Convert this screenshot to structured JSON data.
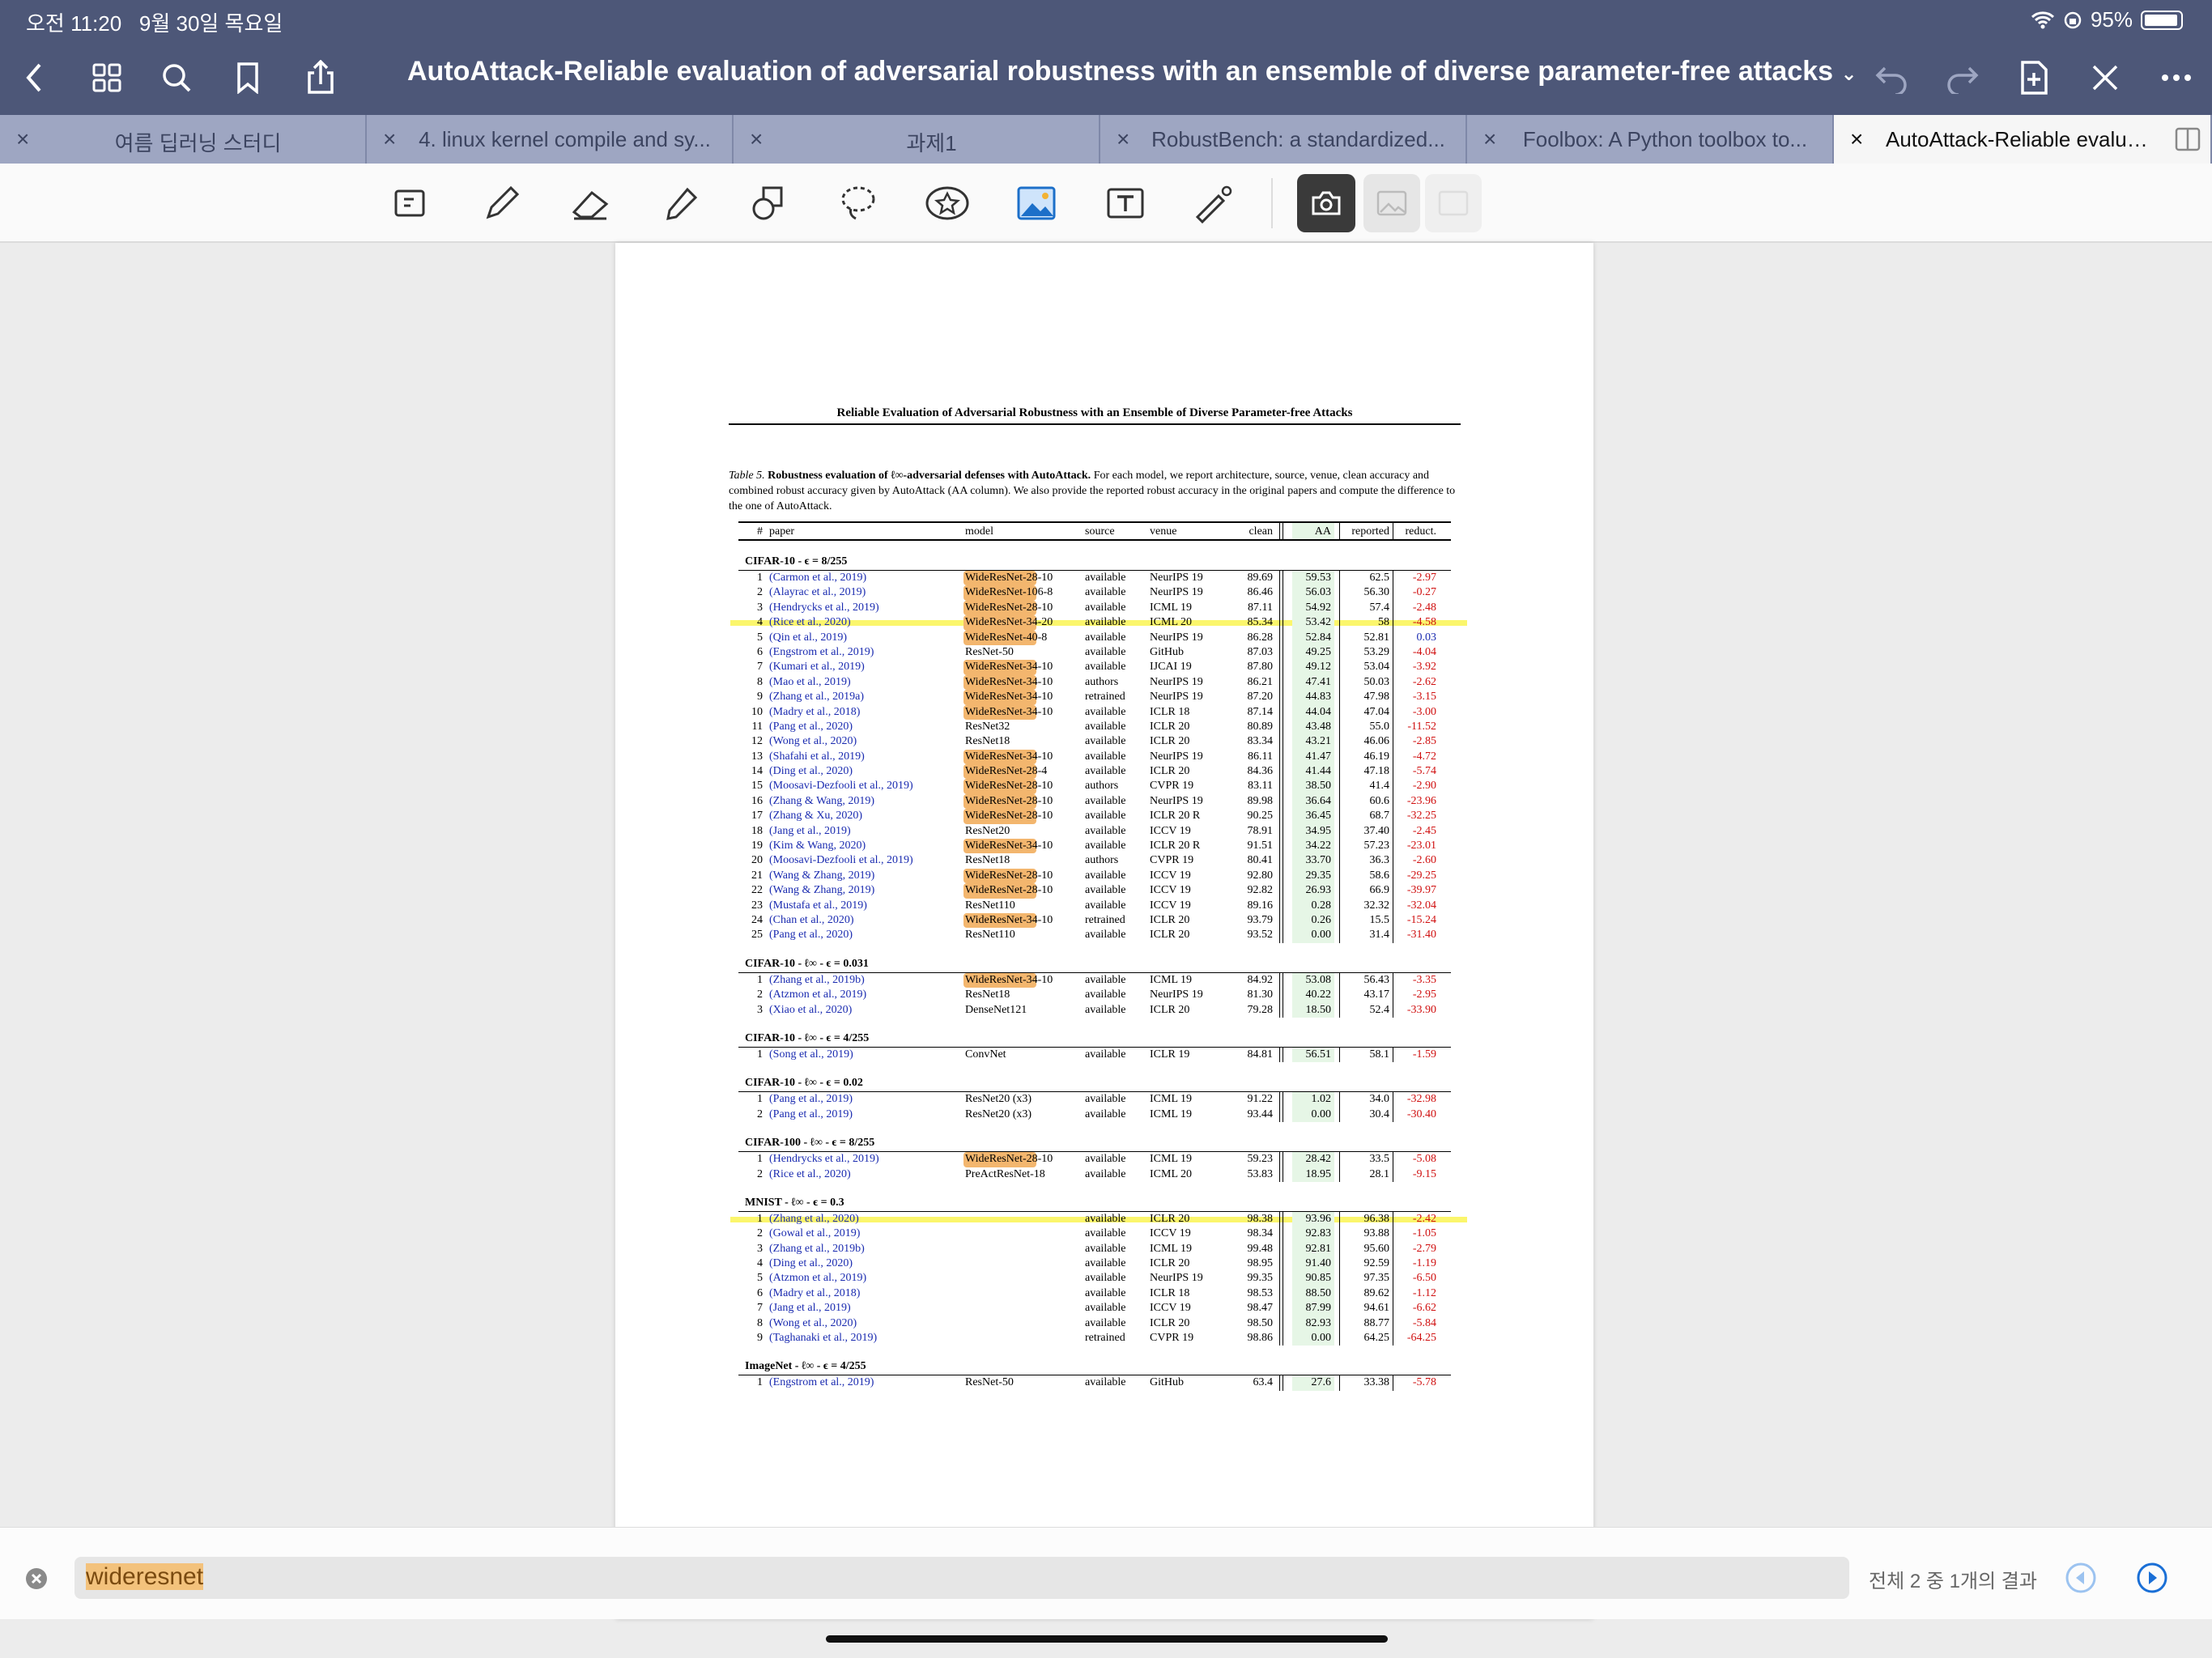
{
  "status": {
    "time": "오전 11:20",
    "date": "9월 30일 목요일",
    "battery": "95%"
  },
  "nav": {
    "title": "AutoAttack-Reliable evaluation of adversarial robustness with an ensemble of diverse parameter-free attacks"
  },
  "tabs": [
    {
      "label": "여름 딥러닝 스터디"
    },
    {
      "label": "4. linux kernel compile and sy..."
    },
    {
      "label": "과제1"
    },
    {
      "label": "RobustBench: a standardized..."
    },
    {
      "label": "Foolbox: A Python toolbox to..."
    },
    {
      "label": "AutoAttack-Reliable evalua..."
    }
  ],
  "doc": {
    "running_head": "Reliable Evaluation of Adversarial Robustness with an Ensemble of Diverse Parameter-free Attacks",
    "caption": {
      "label": "Table 5.",
      "bold": "Robustness evaluation of ℓ∞-adversarial defenses with AutoAttack.",
      "rest": "For each model, we report architecture, source, venue, clean accuracy and combined robust accuracy given by AutoAttack (AA column). We also provide the reported robust accuracy in the original papers and compute the difference to the one of AutoAttack."
    },
    "headers": {
      "num": "#",
      "paper": "paper",
      "model": "model",
      "source": "source",
      "venue": "venue",
      "clean": "clean",
      "aa": "AA",
      "reported": "reported",
      "reduct": "reduct."
    },
    "sections": [
      {
        "title": "CIFAR-10 - ϵ = 8/255",
        "rows": [
          {
            "n": "1",
            "paper": "(Carmon et al., 2019)",
            "model": "WideResNet-28-10",
            "source": "available",
            "venue": "NeurIPS 19",
            "clean": "89.69",
            "aa": "59.53",
            "reported": "62.5",
            "reduct": "-2.97"
          },
          {
            "n": "2",
            "paper": "(Alayrac et al., 2019)",
            "model": "WideResNet-106-8",
            "source": "available",
            "venue": "NeurIPS 19",
            "clean": "86.46",
            "aa": "56.03",
            "reported": "56.30",
            "reduct": "-0.27"
          },
          {
            "n": "3",
            "paper": "(Hendrycks et al., 2019)",
            "model": "WideResNet-28-10",
            "source": "available",
            "venue": "ICML 19",
            "clean": "87.11",
            "aa": "54.92",
            "reported": "57.4",
            "reduct": "-2.48"
          },
          {
            "n": "4",
            "paper": "(Rice et al., 2020)",
            "model": "WideResNet-34-20",
            "source": "available",
            "venue": "ICML 20",
            "clean": "85.34",
            "aa": "53.42",
            "reported": "58",
            "reduct": "-4.58"
          },
          {
            "n": "5",
            "paper": "(Qin et al., 2019)",
            "model": "WideResNet-40-8",
            "source": "available",
            "venue": "NeurIPS 19",
            "clean": "86.28",
            "aa": "52.84",
            "reported": "52.81",
            "reduct": "0.03"
          },
          {
            "n": "6",
            "paper": "(Engstrom et al., 2019)",
            "model": "ResNet-50",
            "source": "available",
            "venue": "GitHub",
            "clean": "87.03",
            "aa": "49.25",
            "reported": "53.29",
            "reduct": "-4.04"
          },
          {
            "n": "7",
            "paper": "(Kumari et al., 2019)",
            "model": "WideResNet-34-10",
            "source": "available",
            "venue": "IJCAI 19",
            "clean": "87.80",
            "aa": "49.12",
            "reported": "53.04",
            "reduct": "-3.92"
          },
          {
            "n": "8",
            "paper": "(Mao et al., 2019)",
            "model": "WideResNet-34-10",
            "source": "authors",
            "venue": "NeurIPS 19",
            "clean": "86.21",
            "aa": "47.41",
            "reported": "50.03",
            "reduct": "-2.62"
          },
          {
            "n": "9",
            "paper": "(Zhang et al., 2019a)",
            "model": "WideResNet-34-10",
            "source": "retrained",
            "venue": "NeurIPS 19",
            "clean": "87.20",
            "aa": "44.83",
            "reported": "47.98",
            "reduct": "-3.15"
          },
          {
            "n": "10",
            "paper": "(Madry et al., 2018)",
            "model": "WideResNet-34-10",
            "source": "available",
            "venue": "ICLR 18",
            "clean": "87.14",
            "aa": "44.04",
            "reported": "47.04",
            "reduct": "-3.00"
          },
          {
            "n": "11",
            "paper": "(Pang et al., 2020)",
            "model": "ResNet32",
            "source": "available",
            "venue": "ICLR 20",
            "clean": "80.89",
            "aa": "43.48",
            "reported": "55.0",
            "reduct": "-11.52"
          },
          {
            "n": "12",
            "paper": "(Wong et al., 2020)",
            "model": "ResNet18",
            "source": "available",
            "venue": "ICLR 20",
            "clean": "83.34",
            "aa": "43.21",
            "reported": "46.06",
            "reduct": "-2.85"
          },
          {
            "n": "13",
            "paper": "(Shafahi et al., 2019)",
            "model": "WideResNet-34-10",
            "source": "available",
            "venue": "NeurIPS 19",
            "clean": "86.11",
            "aa": "41.47",
            "reported": "46.19",
            "reduct": "-4.72"
          },
          {
            "n": "14",
            "paper": "(Ding et al., 2020)",
            "model": "WideResNet-28-4",
            "source": "available",
            "venue": "ICLR 20",
            "clean": "84.36",
            "aa": "41.44",
            "reported": "47.18",
            "reduct": "-5.74"
          },
          {
            "n": "15",
            "paper": "(Moosavi-Dezfooli et al., 2019)",
            "model": "WideResNet-28-10",
            "source": "authors",
            "venue": "CVPR 19",
            "clean": "83.11",
            "aa": "38.50",
            "reported": "41.4",
            "reduct": "-2.90"
          },
          {
            "n": "16",
            "paper": "(Zhang & Wang, 2019)",
            "model": "WideResNet-28-10",
            "source": "available",
            "venue": "NeurIPS 19",
            "clean": "89.98",
            "aa": "36.64",
            "reported": "60.6",
            "reduct": "-23.96"
          },
          {
            "n": "17",
            "paper": "(Zhang & Xu, 2020)",
            "model": "WideResNet-28-10",
            "source": "available",
            "venue": "ICLR 20 R",
            "clean": "90.25",
            "aa": "36.45",
            "reported": "68.7",
            "reduct": "-32.25"
          },
          {
            "n": "18",
            "paper": "(Jang et al., 2019)",
            "model": "ResNet20",
            "source": "available",
            "venue": "ICCV 19",
            "clean": "78.91",
            "aa": "34.95",
            "reported": "37.40",
            "reduct": "-2.45"
          },
          {
            "n": "19",
            "paper": "(Kim & Wang, 2020)",
            "model": "WideResNet-34-10",
            "source": "available",
            "venue": "ICLR 20 R",
            "clean": "91.51",
            "aa": "34.22",
            "reported": "57.23",
            "reduct": "-23.01"
          },
          {
            "n": "20",
            "paper": "(Moosavi-Dezfooli et al., 2019)",
            "model": "ResNet18",
            "source": "authors",
            "venue": "CVPR 19",
            "clean": "80.41",
            "aa": "33.70",
            "reported": "36.3",
            "reduct": "-2.60"
          },
          {
            "n": "21",
            "paper": "(Wang & Zhang, 2019)",
            "model": "WideResNet-28-10",
            "source": "available",
            "venue": "ICCV 19",
            "clean": "92.80",
            "aa": "29.35",
            "reported": "58.6",
            "reduct": "-29.25"
          },
          {
            "n": "22",
            "paper": "(Wang & Zhang, 2019)",
            "model": "WideResNet-28-10",
            "source": "available",
            "venue": "ICCV 19",
            "clean": "92.82",
            "aa": "26.93",
            "reported": "66.9",
            "reduct": "-39.97"
          },
          {
            "n": "23",
            "paper": "(Mustafa et al., 2019)",
            "model": "ResNet110",
            "source": "available",
            "venue": "ICCV 19",
            "clean": "89.16",
            "aa": "0.28",
            "reported": "32.32",
            "reduct": "-32.04"
          },
          {
            "n": "24",
            "paper": "(Chan et al., 2020)",
            "model": "WideResNet-34-10",
            "source": "retrained",
            "venue": "ICLR 20",
            "clean": "93.79",
            "aa": "0.26",
            "reported": "15.5",
            "reduct": "-15.24"
          },
          {
            "n": "25",
            "paper": "(Pang et al., 2020)",
            "model": "ResNet110",
            "source": "available",
            "venue": "ICLR 20",
            "clean": "93.52",
            "aa": "0.00",
            "reported": "31.4",
            "reduct": "-31.40"
          }
        ]
      },
      {
        "title": "CIFAR-10 - ℓ∞ - ϵ = 0.031",
        "rows": [
          {
            "n": "1",
            "paper": "(Zhang et al., 2019b)",
            "model": "WideResNet-34-10",
            "source": "available",
            "venue": "ICML 19",
            "clean": "84.92",
            "aa": "53.08",
            "reported": "56.43",
            "reduct": "-3.35"
          },
          {
            "n": "2",
            "paper": "(Atzmon et al., 2019)",
            "model": "ResNet18",
            "source": "available",
            "venue": "NeurIPS 19",
            "clean": "81.30",
            "aa": "40.22",
            "reported": "43.17",
            "reduct": "-2.95"
          },
          {
            "n": "3",
            "paper": "(Xiao et al., 2020)",
            "model": "DenseNet121",
            "source": "available",
            "venue": "ICLR 20",
            "clean": "79.28",
            "aa": "18.50",
            "reported": "52.4",
            "reduct": "-33.90"
          }
        ]
      },
      {
        "title": "CIFAR-10 - ℓ∞ - ϵ = 4/255",
        "rows": [
          {
            "n": "1",
            "paper": "(Song et al., 2019)",
            "model": "ConvNet",
            "source": "available",
            "venue": "ICLR 19",
            "clean": "84.81",
            "aa": "56.51",
            "reported": "58.1",
            "reduct": "-1.59"
          }
        ]
      },
      {
        "title": "CIFAR-10 - ℓ∞ - ϵ = 0.02",
        "rows": [
          {
            "n": "1",
            "paper": "(Pang et al., 2019)",
            "model": "ResNet20 (x3)",
            "source": "available",
            "venue": "ICML 19",
            "clean": "91.22",
            "aa": "1.02",
            "reported": "34.0",
            "reduct": "-32.98"
          },
          {
            "n": "2",
            "paper": "(Pang et al., 2019)",
            "model": "ResNet20 (x3)",
            "source": "available",
            "venue": "ICML 19",
            "clean": "93.44",
            "aa": "0.00",
            "reported": "30.4",
            "reduct": "-30.40"
          }
        ]
      },
      {
        "title": "CIFAR-100 - ℓ∞ - ϵ = 8/255",
        "rows": [
          {
            "n": "1",
            "paper": "(Hendrycks et al., 2019)",
            "model": "WideResNet-28-10",
            "source": "available",
            "venue": "ICML 19",
            "clean": "59.23",
            "aa": "28.42",
            "reported": "33.5",
            "reduct": "-5.08"
          },
          {
            "n": "2",
            "paper": "(Rice et al., 2020)",
            "model": "PreActResNet-18",
            "source": "available",
            "venue": "ICML 20",
            "clean": "53.83",
            "aa": "18.95",
            "reported": "28.1",
            "reduct": "-9.15"
          }
        ]
      },
      {
        "title": "MNIST - ℓ∞ - ϵ = 0.3",
        "rows": [
          {
            "n": "1",
            "paper": "(Zhang et al., 2020)",
            "model": "",
            "source": "available",
            "venue": "ICLR 20",
            "clean": "98.38",
            "aa": "93.96",
            "reported": "96.38",
            "reduct": "-2.42"
          },
          {
            "n": "2",
            "paper": "(Gowal et al., 2019)",
            "model": "",
            "source": "available",
            "venue": "ICCV 19",
            "clean": "98.34",
            "aa": "92.83",
            "reported": "93.88",
            "reduct": "-1.05"
          },
          {
            "n": "3",
            "paper": "(Zhang et al., 2019b)",
            "model": "",
            "source": "available",
            "venue": "ICML 19",
            "clean": "99.48",
            "aa": "92.81",
            "reported": "95.60",
            "reduct": "-2.79"
          },
          {
            "n": "4",
            "paper": "(Ding et al., 2020)",
            "model": "",
            "source": "available",
            "venue": "ICLR 20",
            "clean": "98.95",
            "aa": "91.40",
            "reported": "92.59",
            "reduct": "-1.19"
          },
          {
            "n": "5",
            "paper": "(Atzmon et al., 2019)",
            "model": "",
            "source": "available",
            "venue": "NeurIPS 19",
            "clean": "99.35",
            "aa": "90.85",
            "reported": "97.35",
            "reduct": "-6.50"
          },
          {
            "n": "6",
            "paper": "(Madry et al., 2018)",
            "model": "",
            "source": "available",
            "venue": "ICLR 18",
            "clean": "98.53",
            "aa": "88.50",
            "reported": "89.62",
            "reduct": "-1.12"
          },
          {
            "n": "7",
            "paper": "(Jang et al., 2019)",
            "model": "",
            "source": "available",
            "venue": "ICCV 19",
            "clean": "98.47",
            "aa": "87.99",
            "reported": "94.61",
            "reduct": "-6.62"
          },
          {
            "n": "8",
            "paper": "(Wong et al., 2020)",
            "model": "",
            "source": "available",
            "venue": "ICLR 20",
            "clean": "98.50",
            "aa": "82.93",
            "reported": "88.77",
            "reduct": "-5.84"
          },
          {
            "n": "9",
            "paper": "(Taghanaki et al., 2019)",
            "model": "",
            "source": "retrained",
            "venue": "CVPR 19",
            "clean": "98.86",
            "aa": "0.00",
            "reported": "64.25",
            "reduct": "-64.25"
          }
        ]
      },
      {
        "title": "ImageNet - ℓ∞ - ϵ = 4/255",
        "rows": [
          {
            "n": "1",
            "paper": "(Engstrom et al., 2019)",
            "model": "ResNet-50",
            "source": "available",
            "venue": "GitHub",
            "clean": "63.4",
            "aa": "27.6",
            "reported": "33.38",
            "reduct": "-5.78"
          }
        ]
      }
    ]
  },
  "search": {
    "query": "wideresnet",
    "result_text": "전체 2 중 1개의 결과"
  },
  "highlight": {
    "search_match": "WideResNet",
    "yellow_lines": [
      "CIFAR-10 - ϵ = 8/255 #4",
      "MNIST - ℓ∞ - ϵ = 0.3 #1"
    ]
  }
}
